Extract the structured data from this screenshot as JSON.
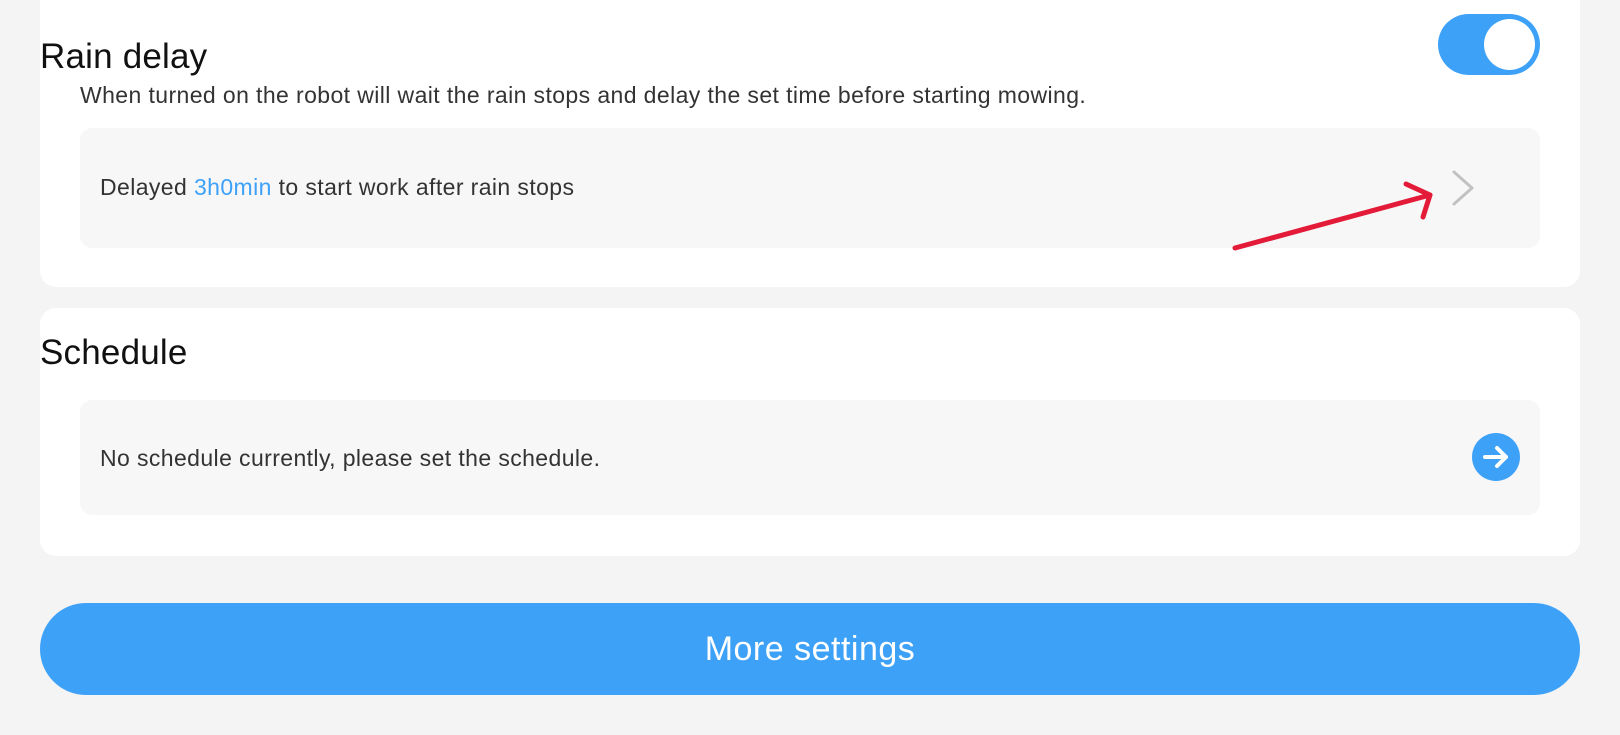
{
  "rain_delay": {
    "title": "Rain delay",
    "toggle_on": true,
    "description": "When turned on the robot will wait the rain stops and delay the set time before starting mowing.",
    "delay_prefix": "Delayed ",
    "delay_value": "3h0min",
    "delay_suffix": " to start work after rain stops",
    "chevron_icon": "chevron-right-icon"
  },
  "schedule": {
    "title": "Schedule",
    "empty_text": "No schedule currently, please set the schedule.",
    "go_icon": "arrow-right-circle-icon"
  },
  "more_settings": {
    "label": "More settings"
  },
  "annotation": {
    "icon": "red-annotation-arrow"
  },
  "colors": {
    "accent": "#3ea1f8",
    "annotation": "#e31a38",
    "background": "#f4f4f4",
    "card": "#ffffff",
    "row_bg": "#f7f7f7"
  }
}
